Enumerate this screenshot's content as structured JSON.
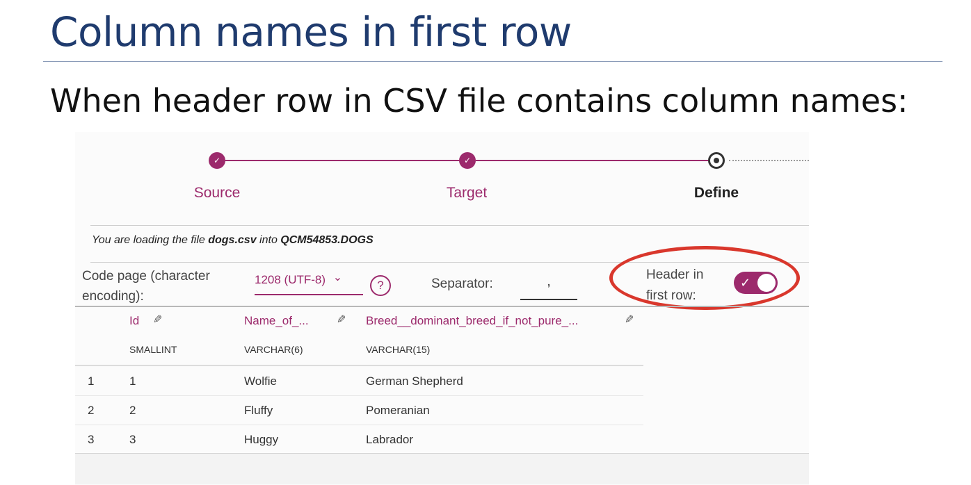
{
  "slide": {
    "title": "Column names in first row",
    "subtitle": "When header row in CSV file contains column names:"
  },
  "stepper": {
    "steps": [
      {
        "label": "Source",
        "state": "done"
      },
      {
        "label": "Target",
        "state": "done"
      },
      {
        "label": "Define",
        "state": "current"
      }
    ],
    "check_glyph": "✓"
  },
  "load_message": {
    "prefix": "You are loading the file ",
    "file": "dogs.csv",
    "middle": " into ",
    "target": "QCM54853.DOGS"
  },
  "options": {
    "code_page_label": "Code page (character encoding):",
    "code_page_value": "1208 (UTF-8)",
    "chevron_glyph": "⌄",
    "help_glyph": "?",
    "separator_label": "Separator:",
    "separator_value": ",",
    "header_label_line1": "Header in",
    "header_label_line2": "first row:",
    "header_toggle_on": true,
    "toggle_check_glyph": "✓"
  },
  "table": {
    "columns": [
      {
        "name": "Id",
        "type": "SMALLINT"
      },
      {
        "name": "Name_of_...",
        "type": "VARCHAR(6)"
      },
      {
        "name": "Breed__dominant_breed_if_not_pure_...",
        "type": "VARCHAR(15)"
      }
    ],
    "pencil_glyph": "✎",
    "rows": [
      {
        "num": "1",
        "cells": [
          "1",
          "Wolfie",
          "German Shepherd"
        ]
      },
      {
        "num": "2",
        "cells": [
          "2",
          "Fluffy",
          "Pomeranian"
        ]
      },
      {
        "num": "3",
        "cells": [
          "3",
          "Huggy",
          "Labrador"
        ]
      }
    ]
  },
  "colors": {
    "accent": "#9c2a6c",
    "highlight_ring": "#d9372c",
    "title": "#1f3b6e"
  }
}
